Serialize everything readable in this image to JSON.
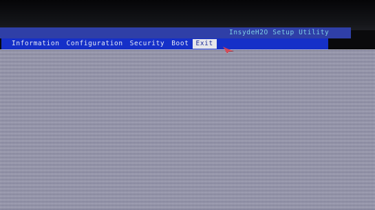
{
  "window": {
    "title": "InsydeH2O Setup Utility"
  },
  "menu": {
    "tabs": [
      {
        "label": "Information"
      },
      {
        "label": "Configuration"
      },
      {
        "label": "Security"
      },
      {
        "label": "Boot"
      },
      {
        "label": "Exit"
      }
    ],
    "active_index": 4
  },
  "colors": {
    "title_bar": "#2f3fa7",
    "menu_bar": "#1530c8",
    "title_text": "#7fd0e6",
    "active_tab_bg": "#e7e7ea",
    "content_bg": "#b8b8c8",
    "cursor": "#e0404a"
  },
  "icons": {
    "pointer": "mouse-pointer-icon"
  }
}
